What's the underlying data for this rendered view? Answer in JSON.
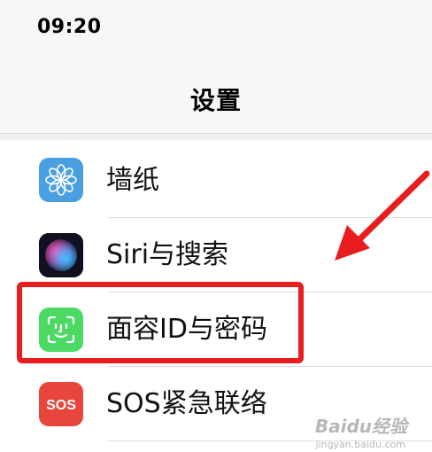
{
  "status_bar": {
    "time": "09:20"
  },
  "nav": {
    "title": "设置"
  },
  "rows": [
    {
      "label": "墙纸",
      "icon": "wallpaper-icon",
      "color": "#4a9fe0"
    },
    {
      "label": "Siri与搜索",
      "icon": "siri-icon",
      "color": "#1b1b2f"
    },
    {
      "label": "面容ID与密码",
      "icon": "face-id-icon",
      "color": "#4cd964"
    },
    {
      "label": "SOS紧急联络",
      "icon": "sos-icon",
      "color": "#e8453c",
      "icon_text": "SOS"
    }
  ],
  "annotation": {
    "highlight_color": "#e81e1e"
  },
  "watermark": {
    "logo": "Baidu经验",
    "sub": "jingyan.baidu.com"
  }
}
